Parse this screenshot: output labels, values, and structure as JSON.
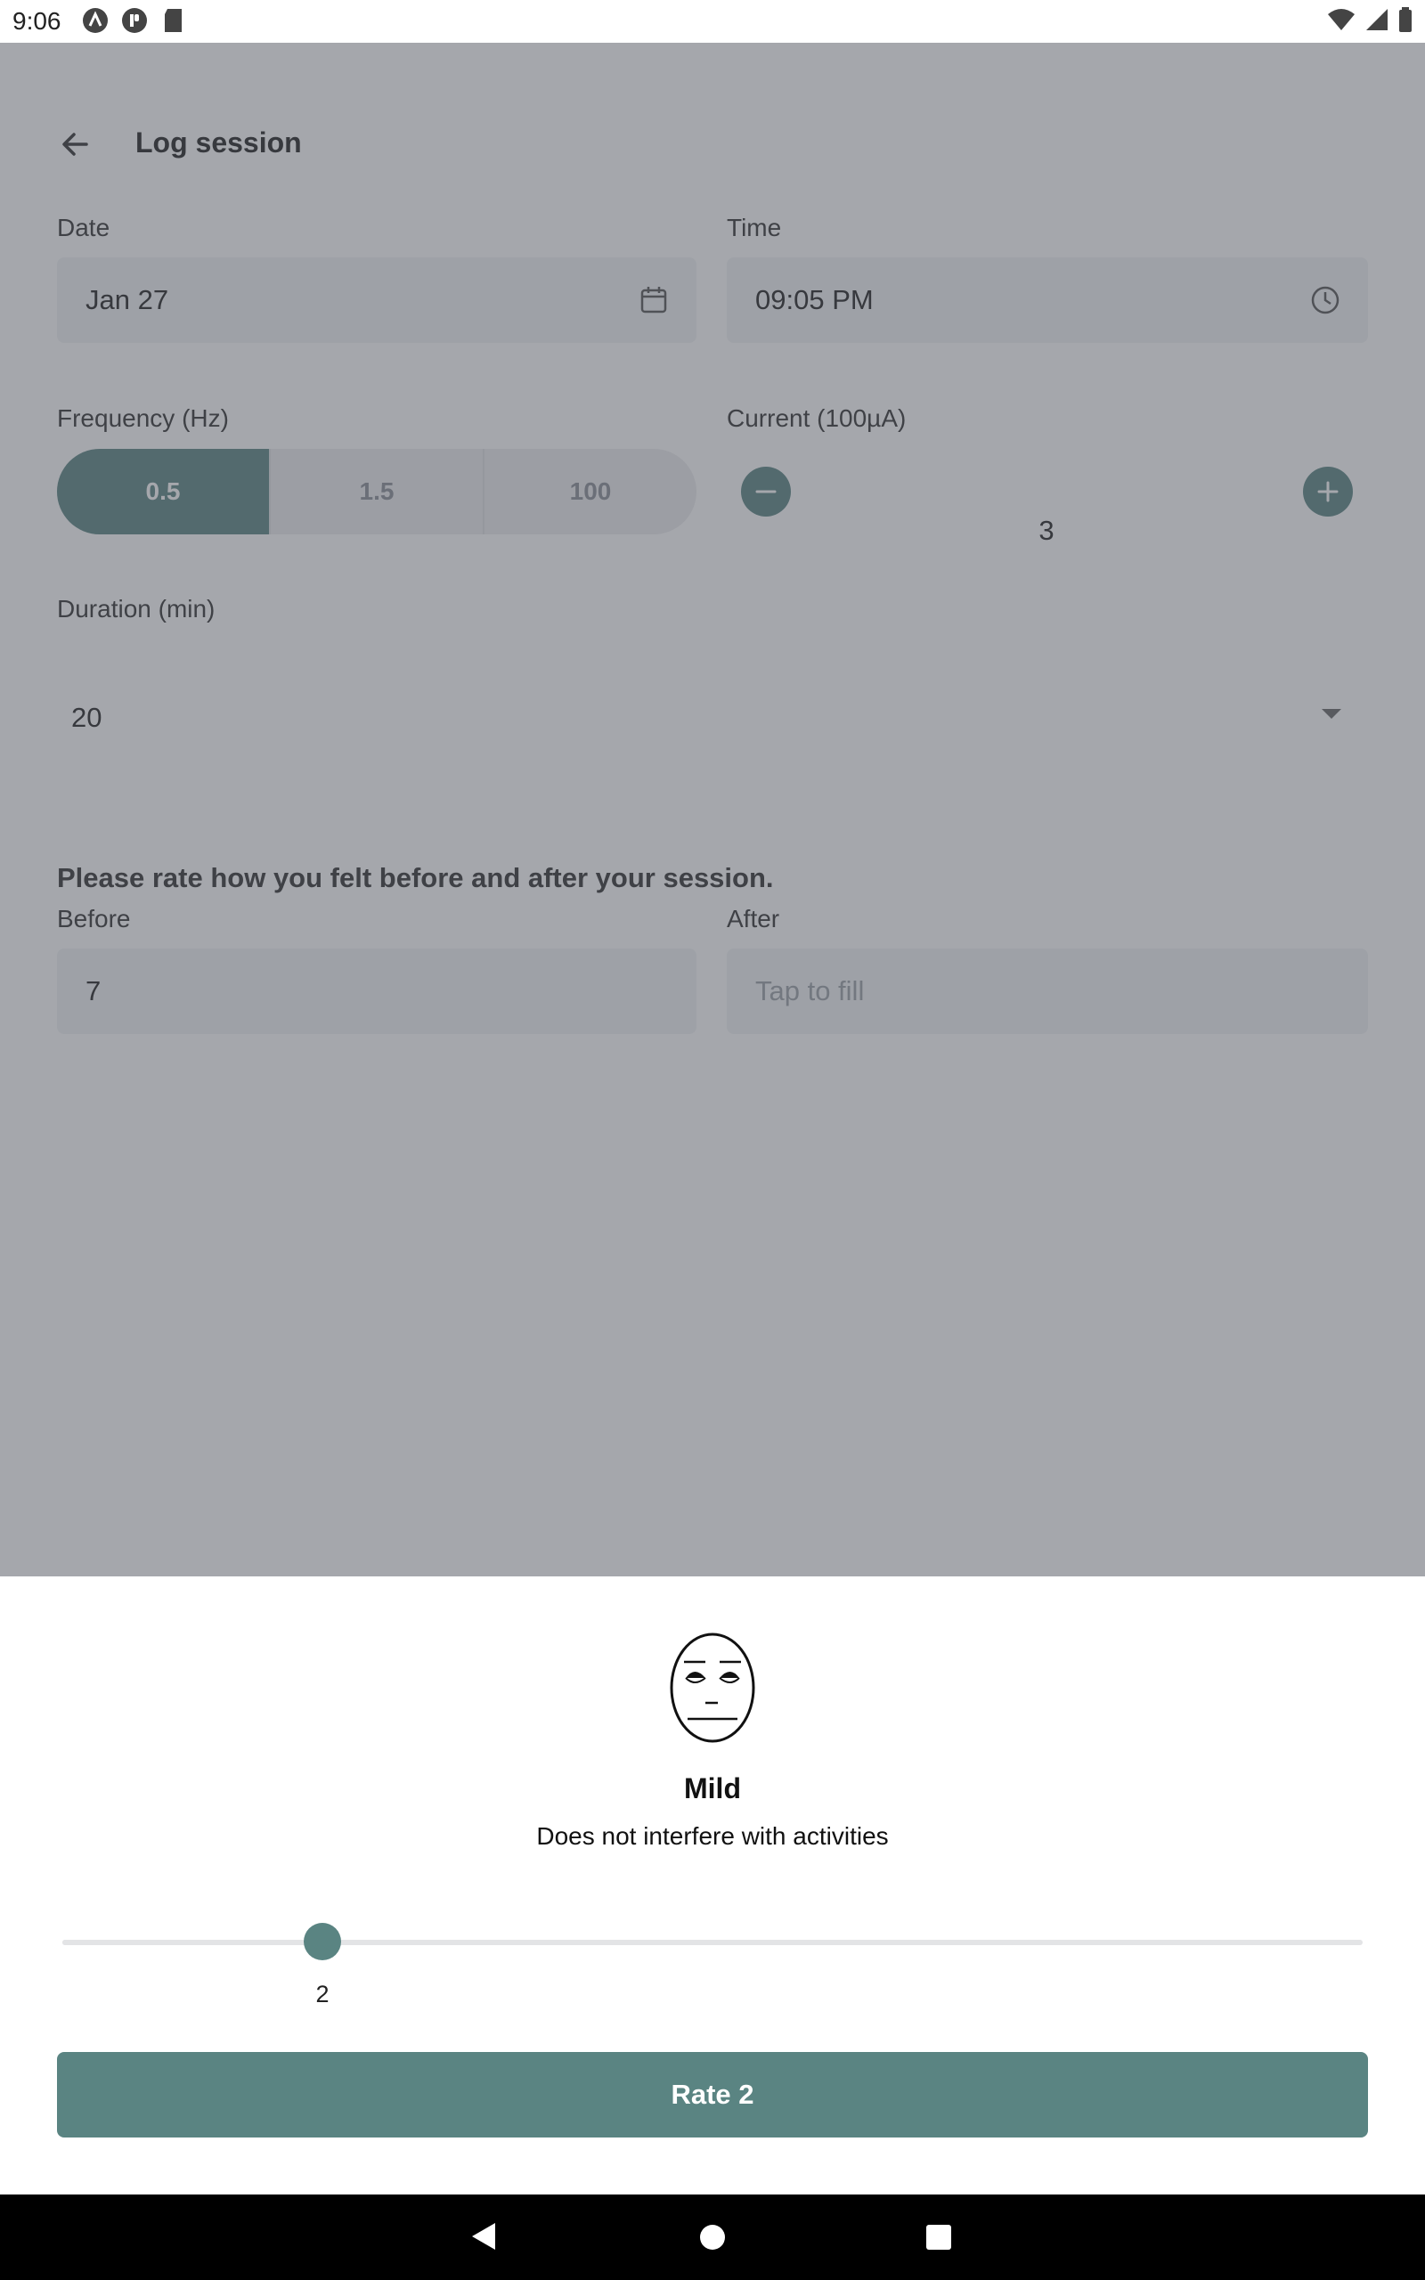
{
  "status_bar": {
    "time": "9:06",
    "left_icons": [
      "a-icon",
      "p-icon",
      "sd-card-icon"
    ],
    "right_icons": [
      "wifi-icon",
      "signal-icon",
      "battery-icon"
    ]
  },
  "header": {
    "title": "Log session",
    "back_icon": "arrow-left-icon"
  },
  "form": {
    "date": {
      "label": "Date",
      "value": "Jan 27",
      "icon": "calendar-icon"
    },
    "time": {
      "label": "Time",
      "value": "09:05 PM",
      "icon": "clock-icon"
    },
    "frequency": {
      "label": "Frequency (Hz)",
      "options": [
        "0.5",
        "1.5",
        "100"
      ],
      "selected": "0.5"
    },
    "current": {
      "label": "Current (100µA)",
      "value": "3",
      "decrement_icon": "minus-icon",
      "increment_icon": "plus-icon"
    },
    "duration": {
      "label": "Duration (min)",
      "value": "20",
      "icon": "chevron-down-icon"
    },
    "rating_prompt": "Please rate how you felt before and after your session.",
    "before": {
      "label": "Before",
      "value": "7"
    },
    "after": {
      "label": "After",
      "placeholder": "Tap to fill"
    }
  },
  "rating_sheet": {
    "face_icon": "neutral-face-icon",
    "title": "Mild",
    "description": "Does not interfere with activities",
    "slider": {
      "value": 2,
      "fraction": 0.2
    },
    "slider_value_label": "2",
    "button_label": "Rate 2"
  },
  "nav_bar": {
    "icons": [
      "back-triangle-icon",
      "home-circle-icon",
      "recents-square-icon"
    ]
  },
  "colors": {
    "accent": "#5a8482",
    "scrim": "#4b505a",
    "field_bg": "#f1f2f4"
  }
}
